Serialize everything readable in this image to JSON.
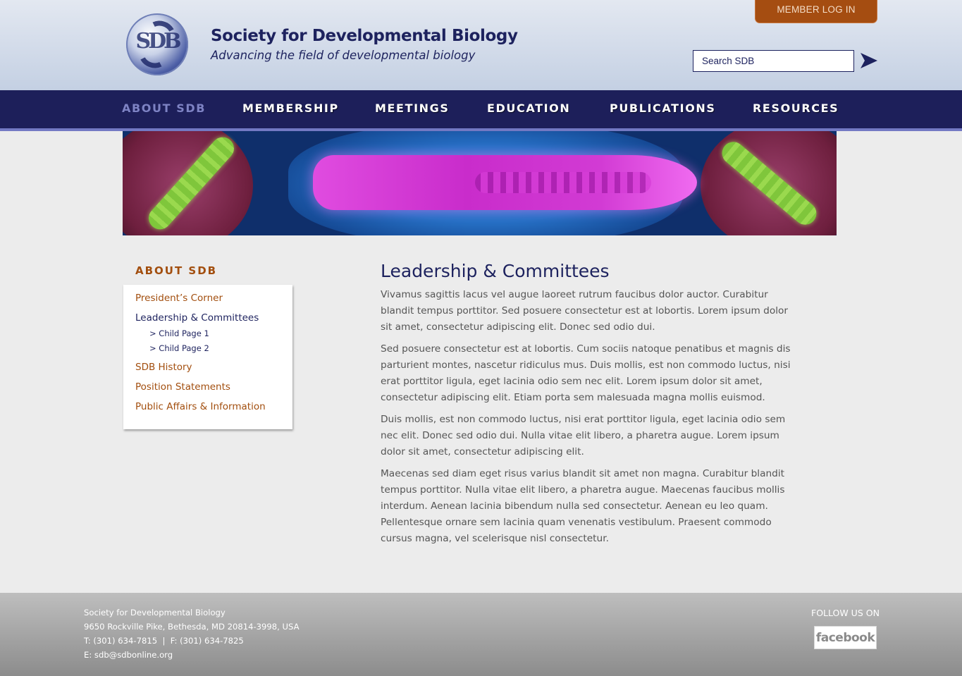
{
  "header": {
    "site_title": "Society for Developmental Biology",
    "tagline": "Advancing the field of developmental biology",
    "member_login": "MEMBER LOG IN",
    "search_placeholder": "Search SDB"
  },
  "nav": {
    "items": [
      {
        "label": "ABOUT SDB",
        "active": true
      },
      {
        "label": "MEMBERSHIP",
        "active": false
      },
      {
        "label": "MEETINGS",
        "active": false
      },
      {
        "label": "EDUCATION",
        "active": false
      },
      {
        "label": "PUBLICATIONS",
        "active": false
      },
      {
        "label": "RESOURCES",
        "active": false
      }
    ]
  },
  "sidebar": {
    "heading": "ABOUT SDB",
    "links": [
      {
        "label": "President’s Corner"
      },
      {
        "label": "Leadership & Committees",
        "current": true
      },
      {
        "label": "SDB History"
      },
      {
        "label": "Position Statements"
      },
      {
        "label": "Public Affairs & Information"
      }
    ],
    "children": [
      {
        "label": "> Child Page 1"
      },
      {
        "label": "> Child Page 2"
      }
    ]
  },
  "main": {
    "title": "Leadership & Committees",
    "paragraphs": [
      "Vivamus sagittis lacus vel augue laoreet rutrum faucibus dolor auctor. Curabitur blandit tempus porttitor. Sed posuere consectetur est at lobortis. Lorem ipsum dolor sit amet, consectetur adipiscing elit. Donec sed odio dui.",
      "Sed posuere consectetur est at lobortis. Cum sociis natoque penatibus et magnis dis parturient montes, nascetur ridiculus mus. Duis mollis, est non commodo luctus, nisi erat porttitor ligula, eget lacinia odio sem nec elit. Lorem ipsum dolor sit amet, consectetur adipiscing elit. Etiam porta sem malesuada magna mollis euismod.",
      "Duis mollis, est non commodo luctus, nisi erat porttitor ligula, eget lacinia odio sem nec elit. Donec sed odio dui. Nulla vitae elit libero, a pharetra augue. Lorem ipsum dolor sit amet, consectetur adipiscing elit.",
      "Maecenas sed diam eget risus varius blandit sit amet non magna. Curabitur blandit tempus porttitor. Nulla vitae elit libero, a pharetra augue. Maecenas faucibus mollis interdum. Aenean lacinia bibendum nulla sed consectetur. Aenean eu leo quam. Pellentesque ornare sem lacinia quam venenatis vestibulum. Praesent commodo cursus magna, vel scelerisque nisl consectetur."
    ]
  },
  "footer": {
    "org": "Society for Developmental Biology",
    "address": "9650 Rockville Pike, Bethesda, MD  20814-3998, USA",
    "phone_fax": "T: (301) 634-7815  |  F: (301) 634-7825",
    "email": "E: sdb@sdbonline.org",
    "follow_label": "FOLLOW US ON",
    "facebook_label": "facebook"
  },
  "colors": {
    "navy": "#1d225e",
    "accent_orange": "#a24e0e",
    "nav_active": "#7e83c4"
  }
}
